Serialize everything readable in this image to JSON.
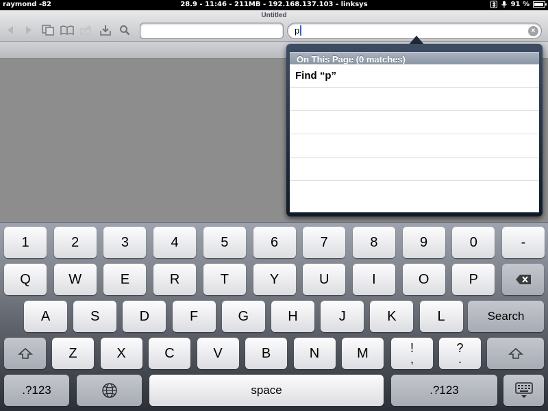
{
  "status_bar": {
    "carrier": "raymond -82",
    "center": "28.9 - 11:46 - 211MB - 192.168.137.103 - linksys",
    "battery_percent": "91 %",
    "battery_level": 0.91,
    "icons": [
      "bluetooth-icon",
      "mic-icon",
      "battery-icon"
    ]
  },
  "browser": {
    "title": "Untitled",
    "toolbar_icons": [
      "back-icon",
      "forward-icon",
      "tabs-icon",
      "bookmarks-icon",
      "share-icon",
      "download-icon",
      "search-icon"
    ],
    "address_value": "",
    "search_value": "p"
  },
  "popover": {
    "header": "On This Page (0 matches)",
    "rows": [
      "Find “p”",
      "",
      "",
      "",
      "",
      ""
    ]
  },
  "keyboard": {
    "row1": [
      "1",
      "2",
      "3",
      "4",
      "5",
      "6",
      "7",
      "8",
      "9",
      "0",
      "-"
    ],
    "row2": [
      "Q",
      "W",
      "E",
      "R",
      "T",
      "Y",
      "U",
      "I",
      "O",
      "P"
    ],
    "row3": [
      "A",
      "S",
      "D",
      "F",
      "G",
      "H",
      "J",
      "K",
      "L"
    ],
    "row4": [
      "Z",
      "X",
      "C",
      "V",
      "B",
      "N",
      "M"
    ],
    "search_label": "Search",
    "space_label": "space",
    "numbers_label": ".?123",
    "punct1_top": "!",
    "punct1_bottom": ",",
    "punct2_top": "?",
    "punct2_bottom": "."
  }
}
